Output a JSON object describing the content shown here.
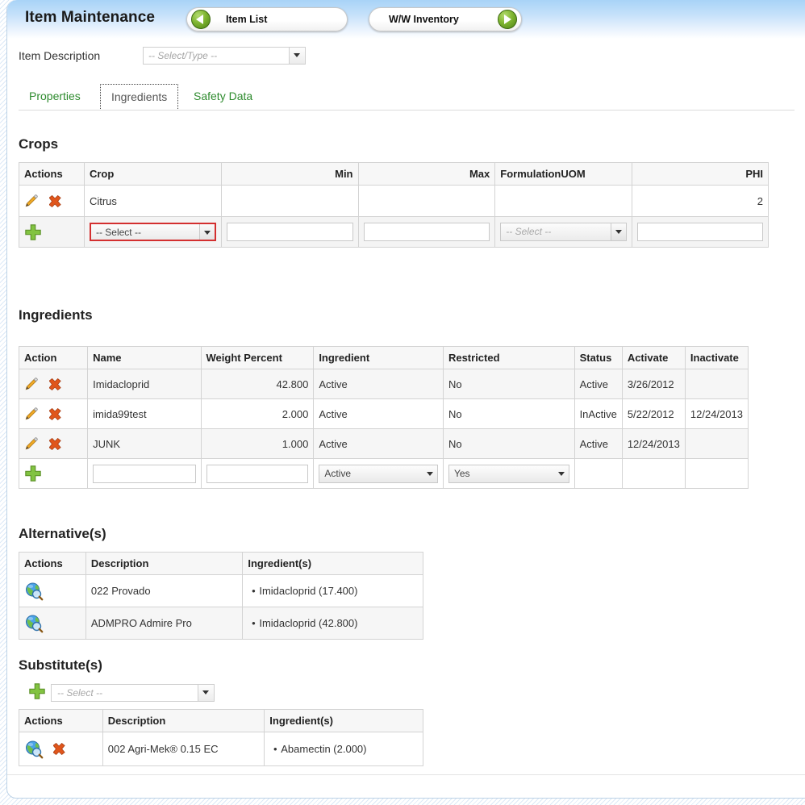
{
  "header": {
    "title": "Item Maintenance",
    "nav_prev": {
      "label": "Item List",
      "icon": "arrow-left-circle-icon"
    },
    "nav_next": {
      "label": "W/W Inventory",
      "icon": "arrow-right-circle-icon"
    }
  },
  "item_description": {
    "label": "Item Description",
    "placeholder": "-- Select/Type --",
    "value": ""
  },
  "tabs": [
    {
      "label": "Properties",
      "active": false
    },
    {
      "label": "Ingredients",
      "active": true
    },
    {
      "label": "Safety Data",
      "active": false
    }
  ],
  "crops": {
    "heading": "Crops",
    "columns": [
      "Actions",
      "Crop",
      "Min",
      "Max",
      "FormulationUOM",
      "PHI"
    ],
    "rows": [
      {
        "crop": "Citrus",
        "min": "",
        "max": "",
        "formulation_uom": "",
        "phi": "2"
      }
    ],
    "add_row": {
      "crop_placeholder": "-- Select --",
      "min_value": "",
      "max_value": "",
      "uom_placeholder": "-- Select --",
      "phi_value": ""
    }
  },
  "ingredients": {
    "heading": "Ingredients",
    "columns": [
      "Action",
      "Name",
      "Weight Percent",
      "Ingredient",
      "Restricted",
      "Status",
      "Activate",
      "Inactivate"
    ],
    "rows": [
      {
        "name": "Imidacloprid",
        "weight_percent": "42.800",
        "ingredient": "Active",
        "restricted": "No",
        "status": "Active",
        "activate": "3/26/2012",
        "inactivate": ""
      },
      {
        "name": "imida99test",
        "weight_percent": "2.000",
        "ingredient": "Active",
        "restricted": "No",
        "status": "InActive",
        "activate": "5/22/2012",
        "inactivate": "12/24/2013"
      },
      {
        "name": "JUNK",
        "weight_percent": "1.000",
        "ingredient": "Active",
        "restricted": "No",
        "status": "Active",
        "activate": "12/24/2013",
        "inactivate": ""
      }
    ],
    "add_row": {
      "name_value": "",
      "weight_percent_value": "",
      "ingredient_selected": "Active",
      "restricted_selected": "Yes"
    }
  },
  "alternatives": {
    "heading": "Alternative(s)",
    "columns": [
      "Actions",
      "Description",
      "Ingredient(s)"
    ],
    "rows": [
      {
        "description": "022 Provado",
        "ingredients": "Imidacloprid (17.400)"
      },
      {
        "description": "ADMPRO Admire Pro",
        "ingredients": "Imidacloprid (42.800)"
      }
    ]
  },
  "substitutes": {
    "heading": "Substitute(s)",
    "add_placeholder": "-- Select --",
    "columns": [
      "Actions",
      "Description",
      "Ingredient(s)"
    ],
    "rows": [
      {
        "description": "002 Agri-Mek® 0.15 EC",
        "ingredients": "Abamectin (2.000)"
      }
    ]
  },
  "icons": {
    "edit": "pencil-icon",
    "delete": "delete-x-icon",
    "add": "add-plus-icon",
    "view": "globe-search-icon",
    "dropdown": "chevron-down-icon"
  },
  "colors": {
    "header_blue": "#a8d3f7",
    "link_green": "#2e8b2e",
    "delete_orange": "#e05a1a",
    "add_green": "#79c143",
    "required_red": "#d32f2f"
  }
}
